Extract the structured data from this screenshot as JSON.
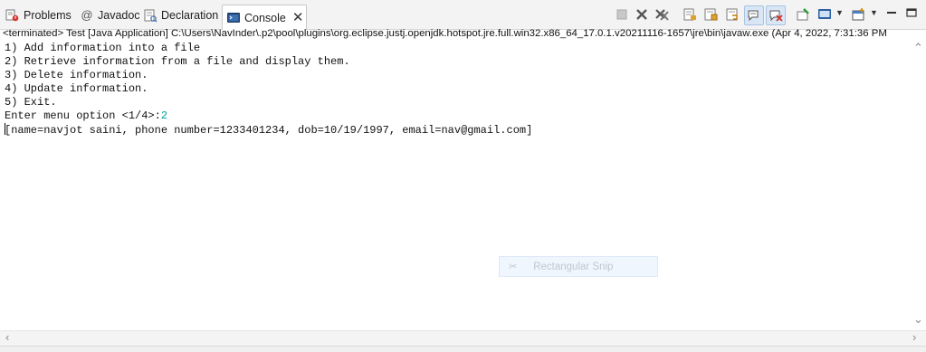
{
  "tabs": [
    {
      "label": "Problems",
      "icon": "problems-icon"
    },
    {
      "label": "Javadoc",
      "icon": "at-icon"
    },
    {
      "label": "Declaration",
      "icon": "declaration-icon"
    },
    {
      "label": "Console",
      "icon": "console-icon",
      "active": true
    }
  ],
  "toolbar": [
    "terminate-icon",
    "remove-launch-icon",
    "remove-all-terminated-icon",
    "clear-console-icon",
    "scroll-lock-icon",
    "word-wrap-icon",
    "show-on-stdout-icon",
    "show-on-stderr-icon",
    "pin-console-icon",
    "display-console-icon",
    "open-console-icon",
    "minimize-icon",
    "maximize-icon"
  ],
  "console": {
    "header": "<terminated> Test [Java Application] C:\\Users\\NavInder\\.p2\\pool\\plugins\\org.eclipse.justj.openjdk.hotspot.jre.full.win32.x86_64_17.0.1.v20211116-1657\\jre\\bin\\javaw.exe  (Apr 4, 2022, 7:31:36 PM",
    "lines": [
      "1) Add information into a file",
      "2) Retrieve information from a file and display them.",
      "3) Delete information.",
      "4) Update information.",
      "5) Exit."
    ],
    "prompt": "Enter menu option <1/4>:",
    "input": "2",
    "output": "[name=navjot saini, phone number=1233401234, dob=10/19/1997, email=nav@gmail.com]"
  },
  "overlay": {
    "label": "Rectangular Snip"
  },
  "colors": {
    "input": "#00a0a0",
    "tab_bar": "#f3f3f3"
  }
}
